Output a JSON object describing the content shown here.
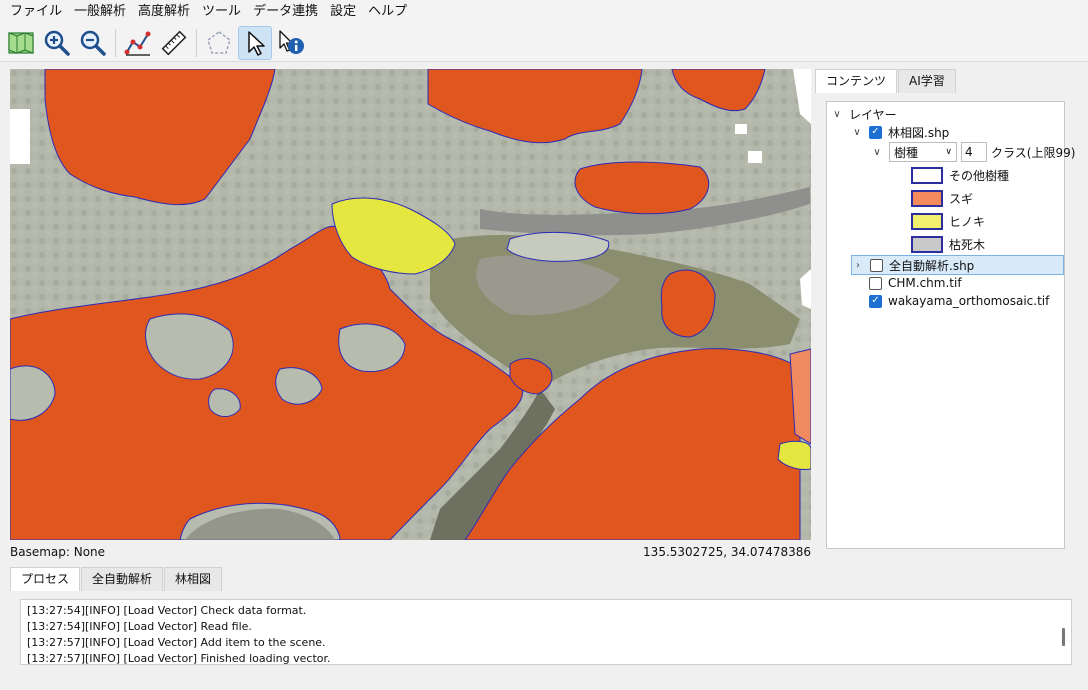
{
  "menu": [
    "ファイル",
    "一般解析",
    "高度解析",
    "ツール",
    "データ連携",
    "設定",
    "ヘルプ"
  ],
  "toolbar": {
    "icons": [
      "map-layers-icon",
      "zoom-in-icon",
      "zoom-out-icon",
      "measure-area-icon",
      "ruler-icon",
      "polygon-draw-icon",
      "select-pointer-icon",
      "identify-info-icon"
    ],
    "active_tool": "select-pointer-icon"
  },
  "map": {
    "basemap_label": "Basemap: None",
    "coordinates": "135.5302725, 34.07478386"
  },
  "right_panel": {
    "tabs": [
      "コンテンツ",
      "AI学習"
    ],
    "selected_tab": "コンテンツ",
    "tree": {
      "root_label": "レイヤー",
      "layer1": {
        "name": "林相図.shp",
        "checked": true,
        "field_value": "樹種",
        "class_count": "4",
        "class_limit_label": "クラス(上限99)",
        "classes": [
          {
            "label": "その他樹種",
            "color": "#ffffff"
          },
          {
            "label": "スギ",
            "color": "#f58a5c"
          },
          {
            "label": "ヒノキ",
            "color": "#f3ef6e"
          },
          {
            "label": "枯死木",
            "color": "#c9c9c9"
          }
        ]
      },
      "layer2": {
        "name": "全自動解析.shp",
        "checked": false
      },
      "layer3": {
        "name": "CHM.chm.tif",
        "checked": false
      },
      "layer4": {
        "name": "wakayama_orthomosaic.tif",
        "checked": true
      }
    }
  },
  "bottom_panel": {
    "tabs": [
      "プロセス",
      "全自動解析",
      "林相図"
    ],
    "selected_tab": "プロセス",
    "log": [
      "[13:27:54][INFO] [Load Vector] Check data format.",
      "[13:27:54][INFO] [Load Vector] Read file.",
      "[13:27:57][INFO] [Load Vector] Add item to the scene.",
      "[13:27:57][INFO] [Load Vector] Finished loading vector."
    ]
  },
  "colors": {
    "sugi": "#e0561f",
    "hinoki": "#e6e640",
    "other": "#b7bcae",
    "outline": "#2b2bb8",
    "accent": "#1d6fd1"
  }
}
